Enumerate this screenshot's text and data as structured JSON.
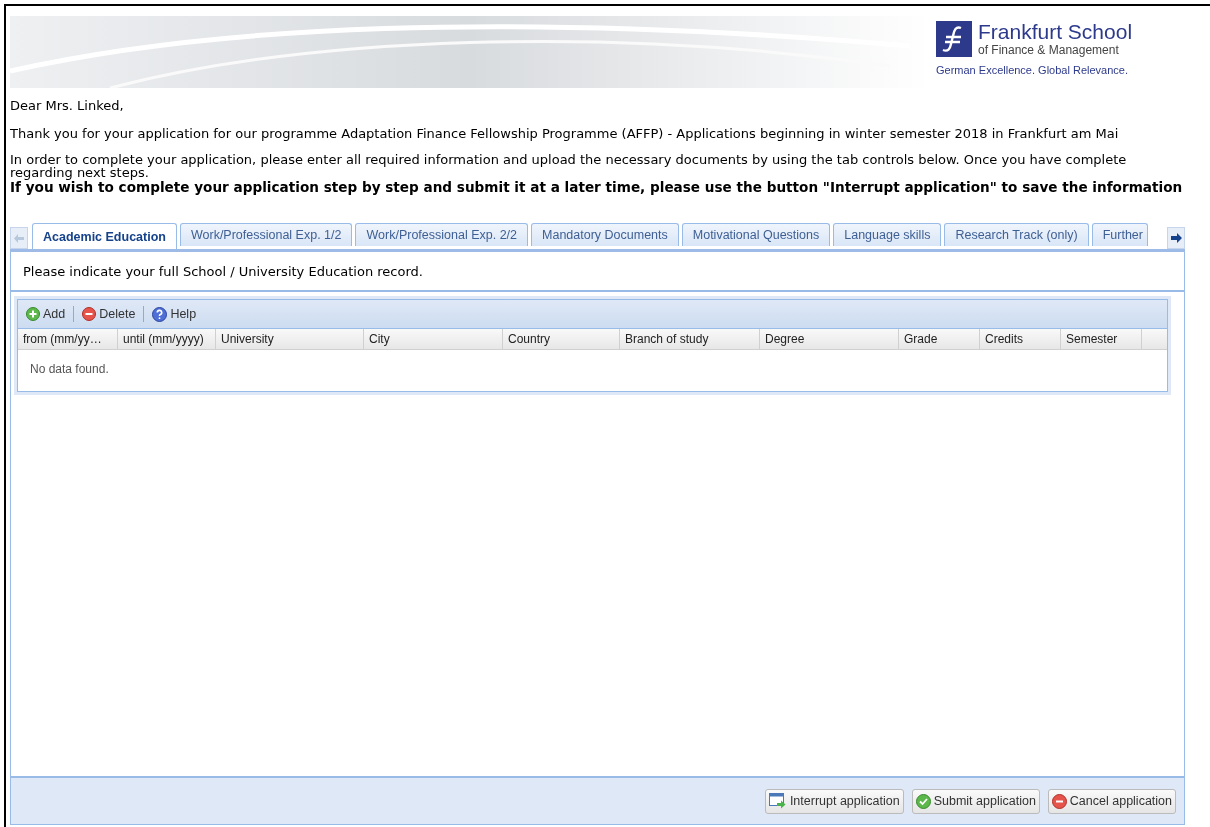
{
  "logo": {
    "name": "Frankfurt School",
    "subtitle": "of Finance & Management",
    "tagline": "German Excellence. Global Relevance."
  },
  "greeting": "Dear Mrs. Linked,",
  "intro": "Thank you for your application for our programme Adaptation Finance Fellowship Programme (AFFP) - Applications beginning in winter semester 2018 in Frankfurt am Mai",
  "instructions": [
    "In order to complete your application, please enter all required information and upload the necessary documents by using the tab controls below. Once you have complete",
    "regarding next steps."
  ],
  "notice": "If you wish to complete your application step by step and submit it at a later time, please use the button \"Interrupt application\" to save the information",
  "tabs": [
    {
      "label": "Academic Education",
      "selected": true
    },
    {
      "label": "Work/Professional Exp. 1/2",
      "selected": false
    },
    {
      "label": "Work/Professional Exp. 2/2",
      "selected": false
    },
    {
      "label": "Mandatory Documents",
      "selected": false
    },
    {
      "label": "Motivational Questions",
      "selected": false
    },
    {
      "label": "Language skills",
      "selected": false
    },
    {
      "label": "Research Track (only)",
      "selected": false
    },
    {
      "label": "Further",
      "selected": false
    }
  ],
  "panel_text": "Please indicate your full School / University Education record.",
  "toolbar": [
    {
      "kind": "add",
      "label": "Add"
    },
    {
      "kind": "delete",
      "label": "Delete"
    },
    {
      "kind": "help",
      "label": "Help"
    }
  ],
  "table": {
    "columns": [
      "from (mm/yy…",
      "until (mm/yyyy)",
      "University",
      "City",
      "Country",
      "Branch of study",
      "Degree",
      "Grade",
      "Credits",
      "Semester"
    ],
    "empty_text": "No data found."
  },
  "buttons": [
    {
      "kind": "interrupt",
      "label": "Interrupt application"
    },
    {
      "kind": "submit",
      "label": "Submit application"
    },
    {
      "kind": "cancel",
      "label": "Cancel application"
    }
  ]
}
